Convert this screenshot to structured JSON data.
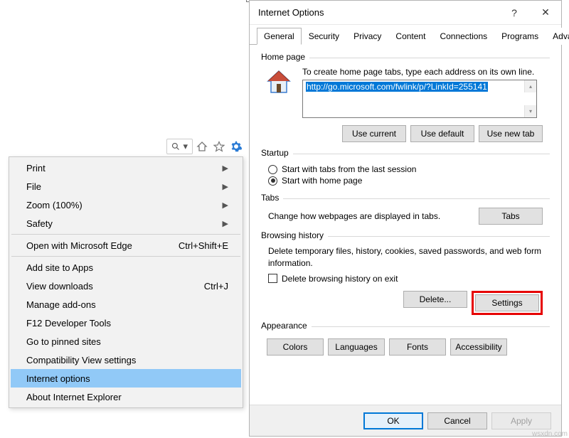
{
  "toolbar": {
    "icons": [
      "search-icon",
      "chevron-down-icon",
      "home-icon",
      "star-icon",
      "gear-icon"
    ]
  },
  "menu": {
    "items": [
      {
        "label": "Print",
        "submenu": true
      },
      {
        "label": "File",
        "submenu": true
      },
      {
        "label": "Zoom (100%)",
        "submenu": true
      },
      {
        "label": "Safety",
        "submenu": true
      },
      {
        "sep": true
      },
      {
        "label": "Open with Microsoft Edge",
        "shortcut": "Ctrl+Shift+E"
      },
      {
        "sep": true
      },
      {
        "label": "Add site to Apps"
      },
      {
        "label": "View downloads",
        "shortcut": "Ctrl+J"
      },
      {
        "label": "Manage add-ons"
      },
      {
        "label": "F12 Developer Tools"
      },
      {
        "label": "Go to pinned sites"
      },
      {
        "label": "Compatibility View settings"
      },
      {
        "label": "Internet options",
        "selected": true
      },
      {
        "label": "About Internet Explorer"
      }
    ]
  },
  "dialog": {
    "title": "Internet Options",
    "help": "?",
    "close": "✕",
    "tabs": [
      "General",
      "Security",
      "Privacy",
      "Content",
      "Connections",
      "Programs",
      "Advanced"
    ],
    "active_tab": 0,
    "homepage": {
      "legend": "Home page",
      "desc": "To create home page tabs, type each address on its own line.",
      "url": "http://go.microsoft.com/fwlink/p/?LinkId=255141",
      "btn_use_current": "Use current",
      "btn_use_default": "Use default",
      "btn_use_new_tab": "Use new tab"
    },
    "startup": {
      "legend": "Startup",
      "opt_last": "Start with tabs from the last session",
      "opt_home": "Start with home page",
      "selected": "home"
    },
    "tabs_group": {
      "legend": "Tabs",
      "desc": "Change how webpages are displayed in tabs.",
      "btn": "Tabs"
    },
    "history": {
      "legend": "Browsing history",
      "desc": "Delete temporary files, history, cookies, saved passwords, and web form information.",
      "chk_label": "Delete browsing history on exit",
      "btn_delete": "Delete...",
      "btn_settings": "Settings"
    },
    "appearance": {
      "legend": "Appearance",
      "btn_colors": "Colors",
      "btn_languages": "Languages",
      "btn_fonts": "Fonts",
      "btn_accessibility": "Accessibility"
    },
    "footer": {
      "ok": "OK",
      "cancel": "Cancel",
      "apply": "Apply"
    }
  },
  "watermark": "wsxdn.com"
}
